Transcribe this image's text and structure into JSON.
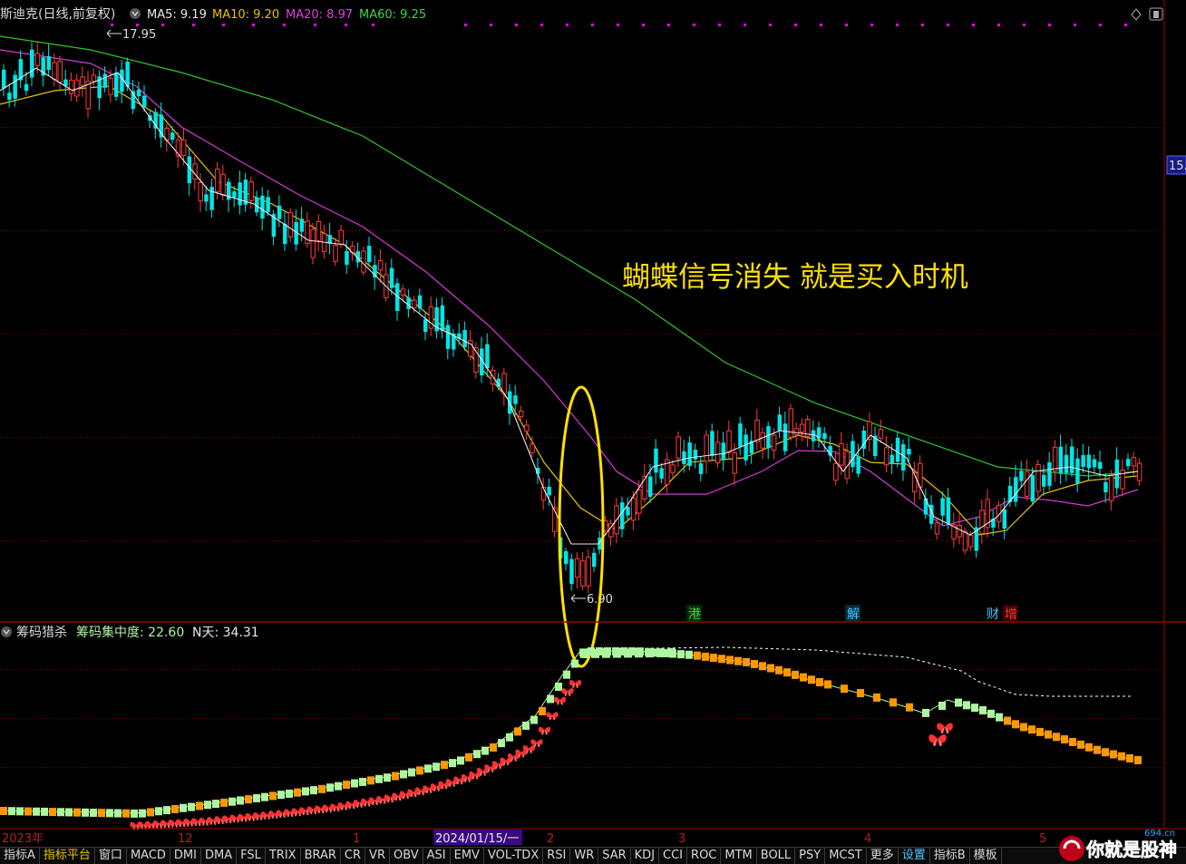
{
  "header": {
    "stock_label": "斯迪克(日线,前复权)",
    "ma": [
      {
        "label": "MA5: 9.19",
        "color": "#e8e8e8"
      },
      {
        "label": "MA10: 9.20",
        "color": "#e6c300"
      },
      {
        "label": "MA20: 8.97",
        "color": "#e040e0"
      },
      {
        "label": "MA60: 9.25",
        "color": "#39d353"
      }
    ]
  },
  "price_panel": {
    "high_label": "17.95",
    "low_label": "6.90",
    "right_price": "15.",
    "annotation": "蝴蝶信号消失  就是买入时机",
    "events": [
      {
        "text": "港",
        "color": "#39d353"
      },
      {
        "text": "解",
        "color": "#4fc3ff"
      },
      {
        "text": "财",
        "color": "#4fc3ff"
      },
      {
        "text": "增",
        "color": "#ff3b3b"
      }
    ]
  },
  "indicator_panel": {
    "name": "筹码猎杀",
    "concentration_label": "筹码集中度: 22.60",
    "nday_label": "N天: 34.31"
  },
  "time_axis": {
    "labels": [
      "2023年",
      "12",
      "1",
      "2024/01/15/一",
      "2",
      "3",
      "4",
      "5"
    ]
  },
  "tabs": [
    "指标A",
    "指标平台",
    "窗口",
    "MACD",
    "DMI",
    "DMA",
    "FSL",
    "TRIX",
    "BRAR",
    "CR",
    "VR",
    "OBV",
    "ASI",
    "EMV",
    "VOL-TDX",
    "RSI",
    "WR",
    "SAR",
    "KDJ",
    "CCI",
    "ROC",
    "MTM",
    "BOLL",
    "PSY",
    "MCST",
    "更多",
    "设置"
  ],
  "tabs_right": [
    "指标B",
    "模板"
  ],
  "watermark": {
    "text": "你就是股神",
    "sub": "694.cn"
  },
  "colors": {
    "up": "#ff3b3b",
    "down": "#00e5e5",
    "grid": "#7a0000",
    "orange": "#ff9800",
    "lightgreen": "#aef5a0"
  }
}
